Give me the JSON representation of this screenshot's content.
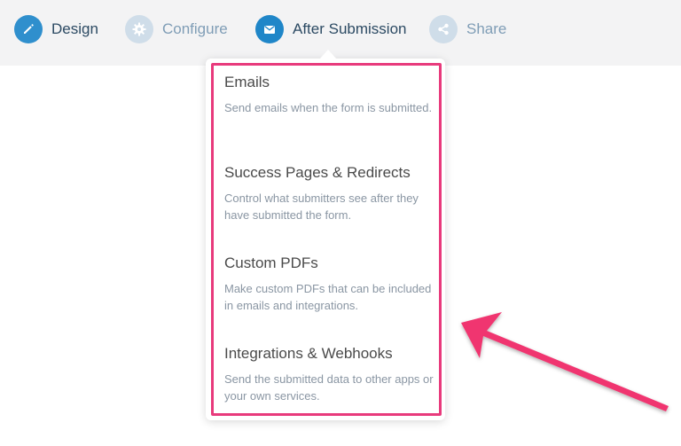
{
  "nav": {
    "items": [
      {
        "label": "Design",
        "icon": "pencil-icon"
      },
      {
        "label": "Configure",
        "icon": "gear-icon"
      },
      {
        "label": "After Submission",
        "icon": "envelope-icon"
      },
      {
        "label": "Share",
        "icon": "share-icon"
      }
    ],
    "active": "After Submission"
  },
  "dropdown": {
    "items": [
      {
        "title": "Emails",
        "description": "Send emails when the form is submitted."
      },
      {
        "title": "Success Pages & Redirects",
        "description": "Control what submitters see after they have submitted the form."
      },
      {
        "title": "Custom PDFs",
        "description": "Make custom PDFs that can be included in emails and integrations."
      },
      {
        "title": "Integrations & Webhooks",
        "description": "Send the submitted data to other apps or your own services."
      }
    ]
  },
  "colors": {
    "highlight": "#e83a7c",
    "accent": "#1f86c8",
    "inactive_icon": "#cfdde9"
  }
}
